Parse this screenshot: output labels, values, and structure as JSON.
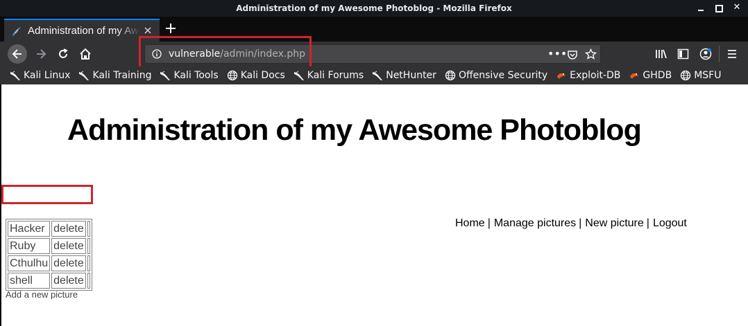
{
  "window": {
    "title": "Administration of my Awesome Photoblog - Mozilla Firefox"
  },
  "tab": {
    "title": "Administration of my Awesome Photoblog"
  },
  "url": {
    "host": "vulnerable",
    "path": "/admin/index.php"
  },
  "bookmarks": [
    {
      "label": "Kali Linux",
      "icon": "kali-dragon-icon"
    },
    {
      "label": "Kali Training",
      "icon": "kali-dragon-icon"
    },
    {
      "label": "Kali Tools",
      "icon": "kali-dragon-icon"
    },
    {
      "label": "Kali Docs",
      "icon": "globe-icon"
    },
    {
      "label": "Kali Forums",
      "icon": "kali-dragon-icon"
    },
    {
      "label": "NetHunter",
      "icon": "kali-dragon-icon"
    },
    {
      "label": "Offensive Security",
      "icon": "globe-icon"
    },
    {
      "label": "Exploit-DB",
      "icon": "exploitdb-icon"
    },
    {
      "label": "GHDB",
      "icon": "exploitdb-icon"
    },
    {
      "label": "MSFU",
      "icon": "globe-icon"
    }
  ],
  "page": {
    "title": "Administration of my Awesome Photoblog",
    "menu": [
      "Home",
      "Manage pictures",
      "New picture",
      "Logout"
    ],
    "menu_separator": "|",
    "pictures": [
      {
        "name": "Hacker",
        "action": "delete"
      },
      {
        "name": "Ruby",
        "action": "delete"
      },
      {
        "name": "Cthulhu",
        "action": "delete"
      },
      {
        "name": "shell",
        "action": "delete"
      }
    ],
    "add_link": "Add a new picture"
  },
  "colors": {
    "highlight": "#d2232a",
    "accent": "#0a84ff",
    "chrome": "#323234"
  }
}
